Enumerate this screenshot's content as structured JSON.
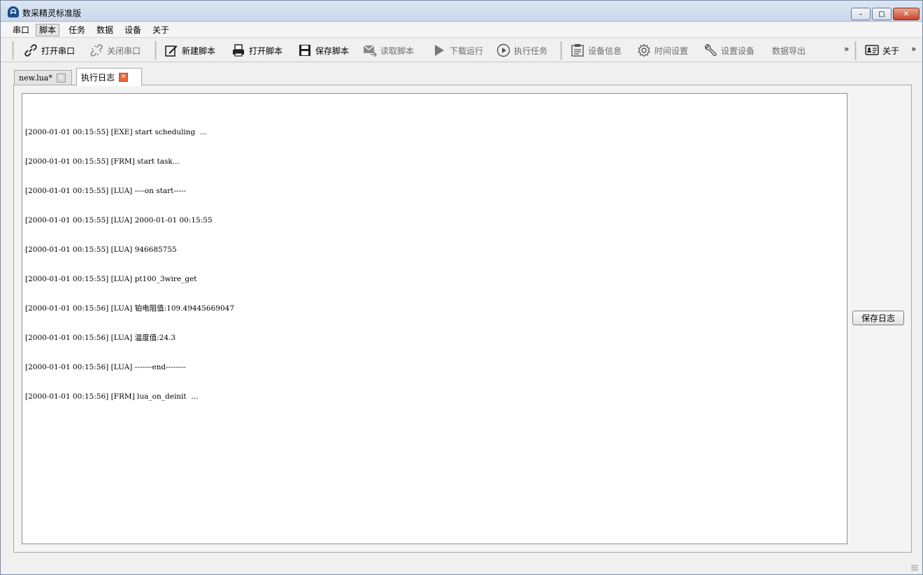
{
  "window": {
    "title": "数采精灵标准版",
    "app_icon_glyph": "ᗣ",
    "minimize_glyph": "–",
    "maximize_glyph": "□",
    "close_glyph": "✕"
  },
  "menu": {
    "items": [
      "串口",
      "脚本",
      "任务",
      "数据",
      "设备",
      "关于"
    ],
    "active": "脚本"
  },
  "toolbar": {
    "open_port": "打开串口",
    "close_port": "关闭串口",
    "new_script": "新建脚本",
    "open_script": "打开脚本",
    "save_script": "保存脚本",
    "read_script": "读取脚本",
    "download_run": "下载运行",
    "exec_task": "执行任务",
    "device_info": "设备信息",
    "time_settings": "时间设置",
    "set_device": "设置设备",
    "data_export": "数据导出",
    "overflow": "»",
    "about": "关于",
    "overflow2": "»"
  },
  "tabs": [
    {
      "label": "new.lua*",
      "close": "✕"
    },
    {
      "label": "执行日志",
      "close": "✕"
    }
  ],
  "log": {
    "lines": [
      "[2000-01-01 00:15:55] [EXE] start scheduling  ...",
      "[2000-01-01 00:15:55] [FRM] start task...",
      "[2000-01-01 00:15:55] [LUA] ----on start-----",
      "[2000-01-01 00:15:55] [LUA] 2000-01-01 00:15:55",
      "[2000-01-01 00:15:55] [LUA] 946685755",
      "[2000-01-01 00:15:55] [LUA] pt100_3wire_get",
      "[2000-01-01 00:15:56] [LUA] 铂电阻值:109.49445669047",
      "[2000-01-01 00:15:56] [LUA] 温度值:24.3",
      "[2000-01-01 00:15:56] [LUA] -------end--------",
      "[2000-01-01 00:15:56] [FRM] lua_on_deinit  ..."
    ]
  },
  "save_log_button": "保存日志",
  "icons": {
    "open_port": "link-icon",
    "close_port": "broken-link-icon",
    "new_script": "edit-pen-icon",
    "open_script": "printer-icon",
    "save_script": "floppy-icon",
    "read_script": "mail-arrow-icon",
    "download_run": "play-triangle-icon",
    "exec_task": "play-circle-icon",
    "device_info": "clipboard-list-icon",
    "time_settings": "gear-icon",
    "set_device": "wrench-icon",
    "about": "id-card-icon"
  }
}
